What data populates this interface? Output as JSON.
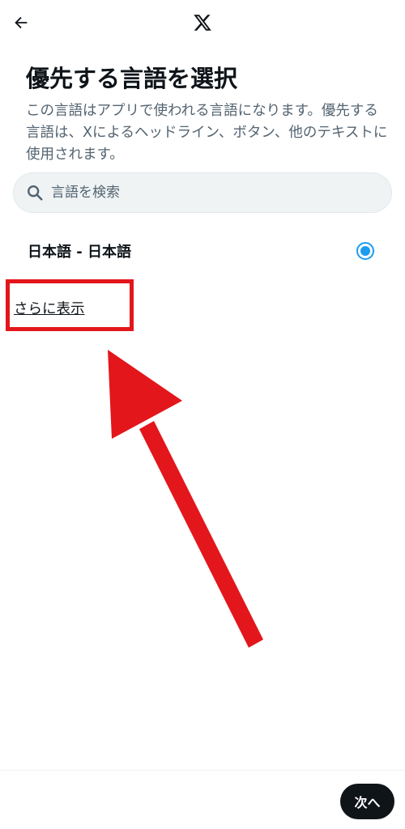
{
  "header": {
    "back_icon": "arrow-left-icon",
    "logo_icon": "x-logo-icon"
  },
  "page": {
    "title": "優先する言語を選択",
    "description": "この言語はアプリで使われる言語になります。優先する言語は、Xによるヘッドライン、ボタン、他のテキストに使用されます。"
  },
  "search": {
    "icon": "search-icon",
    "placeholder": "言語を検索",
    "value": ""
  },
  "languages": {
    "items": [
      {
        "label": "日本語 - 日本語",
        "selected": true
      }
    ]
  },
  "show_more": {
    "label": "さらに表示"
  },
  "footer": {
    "next_label": "次へ"
  },
  "colors": {
    "accent": "#1d9bf0",
    "text": "#0f1419",
    "secondary_text": "#536471",
    "annotation": "#e3161b"
  }
}
